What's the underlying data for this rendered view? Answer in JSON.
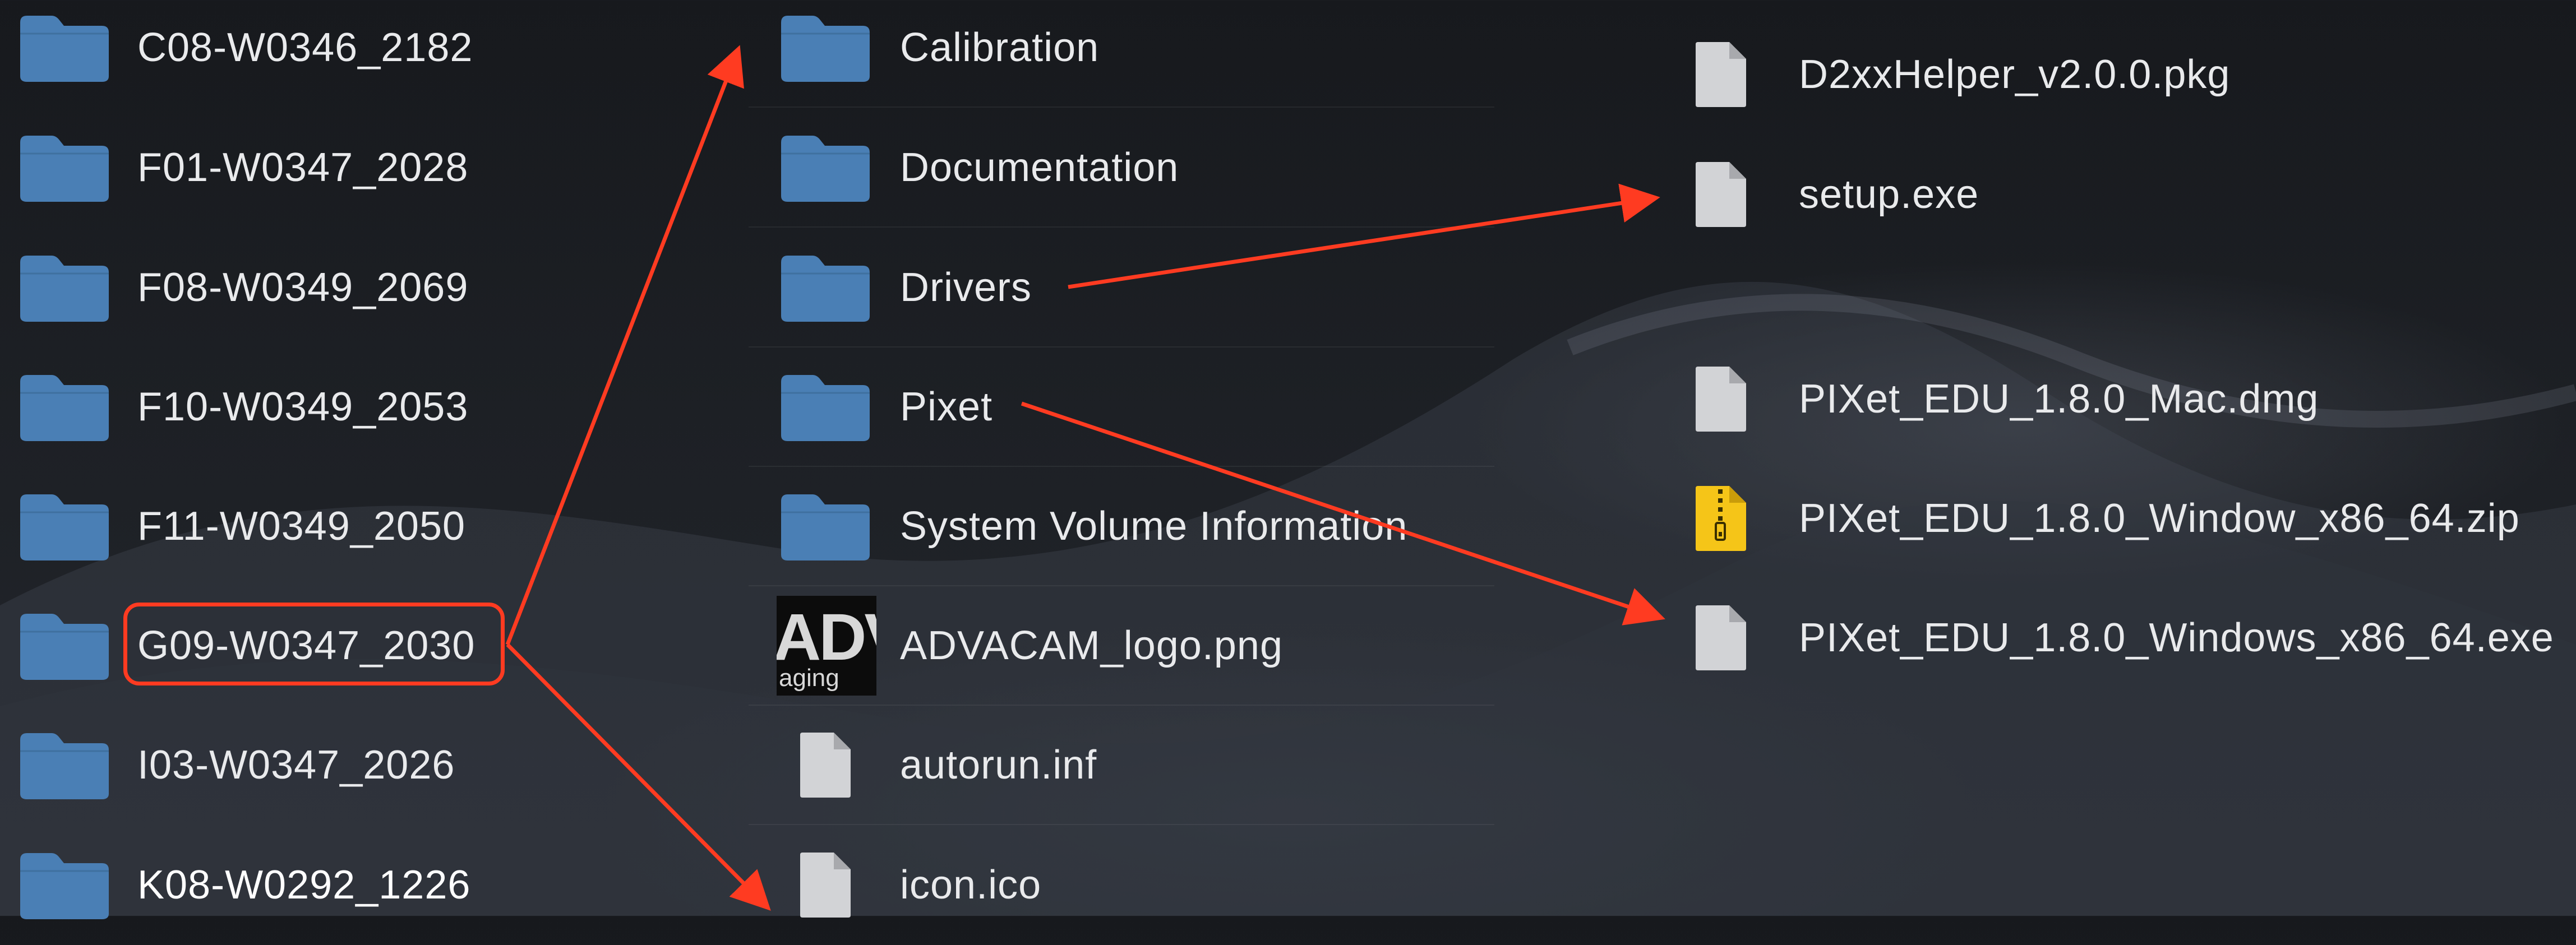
{
  "colors": {
    "folder": "#4a7fb5",
    "file": "#d2d3d6",
    "zip": "#f5c518",
    "annotation": "#ff3b21"
  },
  "column1": {
    "items": [
      {
        "label": "C08-W0346_2182",
        "icon": "folder-icon"
      },
      {
        "label": "F01-W0347_2028",
        "icon": "folder-icon"
      },
      {
        "label": "F08-W0349_2069",
        "icon": "folder-icon"
      },
      {
        "label": "F10-W0349_2053",
        "icon": "folder-icon"
      },
      {
        "label": "F11-W0349_2050",
        "icon": "folder-icon"
      },
      {
        "label": "G09-W0347_2030",
        "icon": "folder-icon",
        "highlighted": true
      },
      {
        "label": "I03-W0347_2026",
        "icon": "folder-icon"
      },
      {
        "label": "K08-W0292_1226",
        "icon": "folder-icon"
      }
    ]
  },
  "column2": {
    "items": [
      {
        "label": "Calibration",
        "icon": "folder-icon"
      },
      {
        "label": "Documentation",
        "icon": "folder-icon"
      },
      {
        "label": "Drivers",
        "icon": "folder-icon"
      },
      {
        "label": "Pixet",
        "icon": "folder-icon"
      },
      {
        "label": "System Volume Information",
        "icon": "folder-icon"
      },
      {
        "label": "ADVACAM_logo.png",
        "icon": "image-thumbnail-icon",
        "thumb_big": "ADVA",
        "thumb_small": "aging"
      },
      {
        "label": "autorun.inf",
        "icon": "file-icon"
      },
      {
        "label": "icon.ico",
        "icon": "file-icon"
      }
    ]
  },
  "drivers_contents": {
    "items": [
      {
        "label": "D2xxHelper_v2.0.0.pkg",
        "icon": "file-icon"
      },
      {
        "label": "setup.exe",
        "icon": "file-icon"
      }
    ]
  },
  "pixet_contents": {
    "items": [
      {
        "label": "PIXet_EDU_1.8.0_Mac.dmg",
        "icon": "file-icon"
      },
      {
        "label": "PIXet_EDU_1.8.0_Window_x86_64.zip",
        "icon": "zip-icon"
      },
      {
        "label": "PIXet_EDU_1.8.0_Windows_x86_64.exe",
        "icon": "file-icon"
      }
    ]
  }
}
